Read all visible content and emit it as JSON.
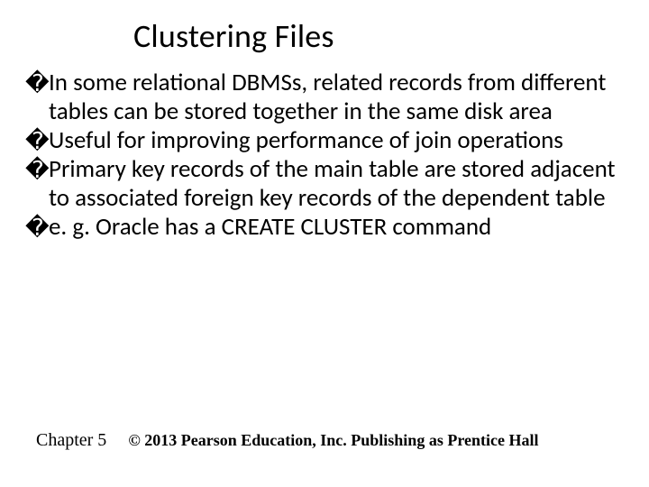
{
  "title": "Clustering Files",
  "bullets": [
    {
      "marker": "�",
      "text": "In some relational DBMSs, related records from different tables can be stored together in the same disk area"
    },
    {
      "marker": "�",
      "text": "Useful for improving performance of join operations"
    },
    {
      "marker": "�",
      "text": "Primary key records of the main table are stored adjacent to associated foreign key records of the dependent table"
    },
    {
      "marker": "�",
      "text": "e. g. Oracle has a CREATE CLUSTER command"
    }
  ],
  "footer": {
    "chapter": "Chapter 5",
    "copyright": "© 2013 Pearson Education, Inc.  Publishing as Prentice Hall"
  }
}
